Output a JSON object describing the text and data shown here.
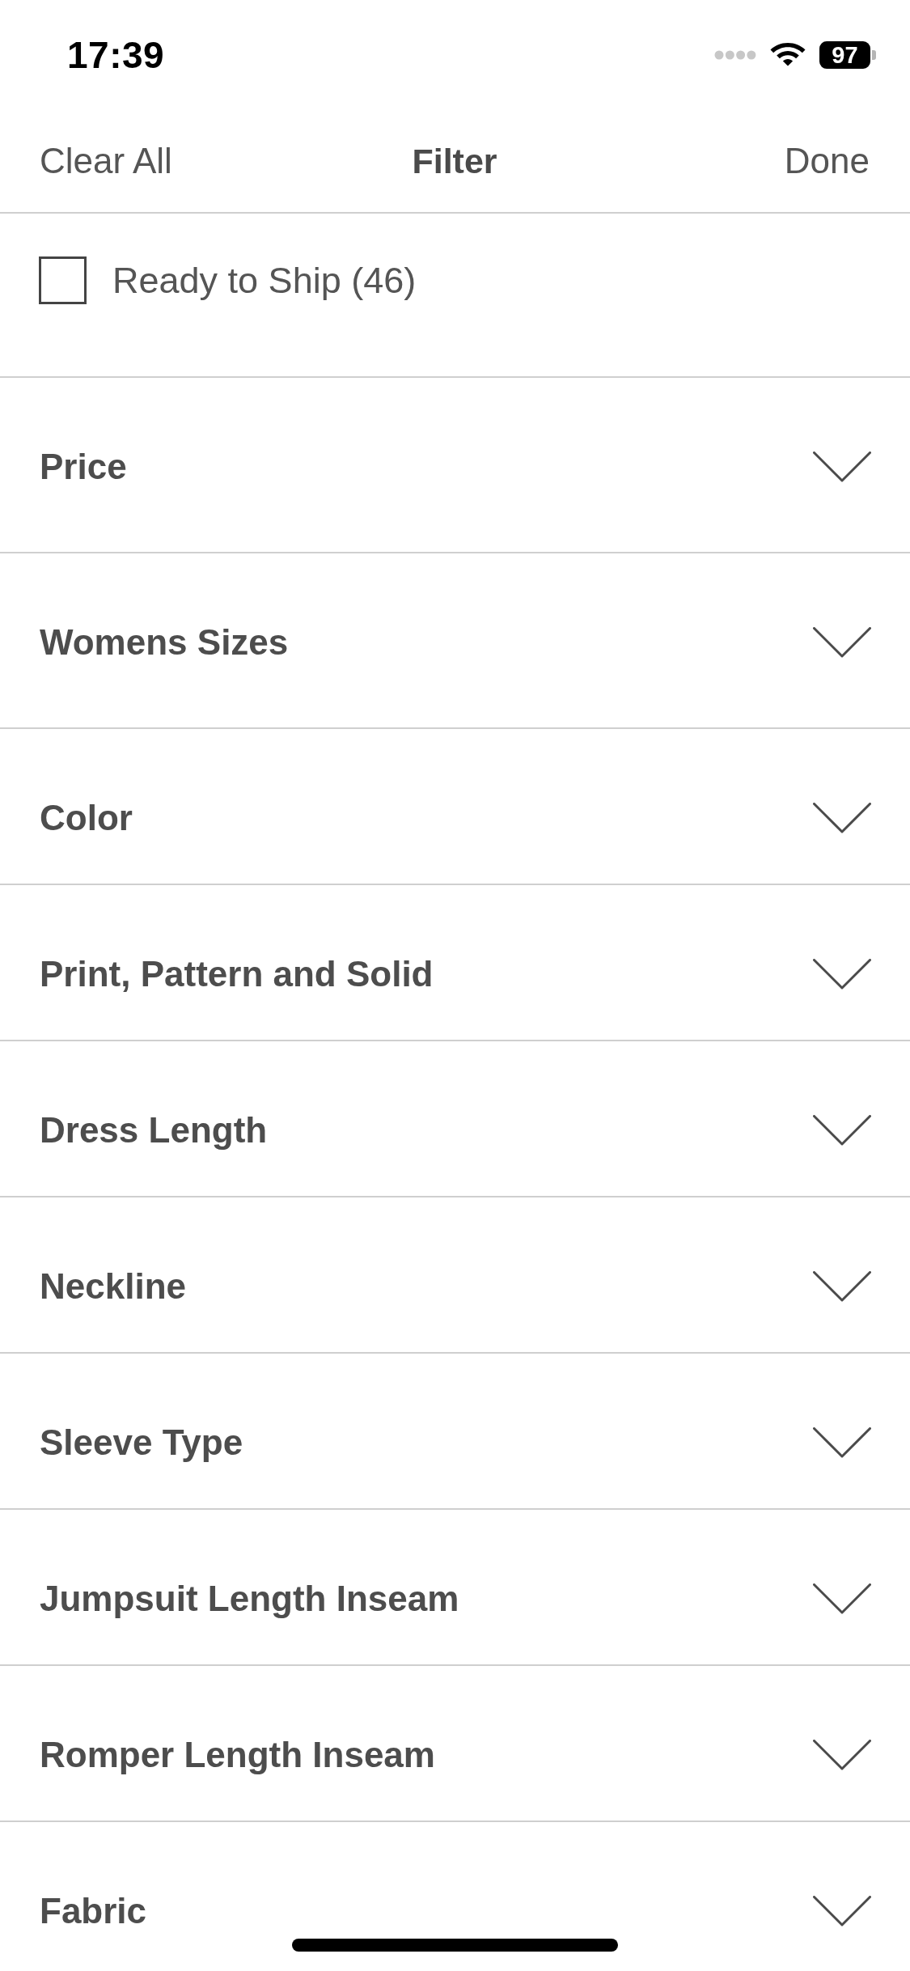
{
  "status_bar": {
    "time": "17:39",
    "battery": "97"
  },
  "nav": {
    "left": "Clear All",
    "title": "Filter",
    "right": "Done"
  },
  "ready_to_ship": {
    "label": "Ready to Ship (46)",
    "checked": false
  },
  "filters": [
    {
      "label": "Price",
      "expanded": false
    },
    {
      "label": "Womens Sizes",
      "expanded": false
    },
    {
      "label": "Color",
      "expanded": false
    },
    {
      "label": "Print, Pattern and Solid",
      "expanded": false
    },
    {
      "label": "Dress Length",
      "expanded": false
    },
    {
      "label": "Neckline",
      "expanded": false
    },
    {
      "label": "Sleeve Type",
      "expanded": false
    },
    {
      "label": "Jumpsuit Length Inseam",
      "expanded": false
    },
    {
      "label": "Romper Length Inseam",
      "expanded": false
    },
    {
      "label": "Fabric",
      "expanded": false
    }
  ]
}
